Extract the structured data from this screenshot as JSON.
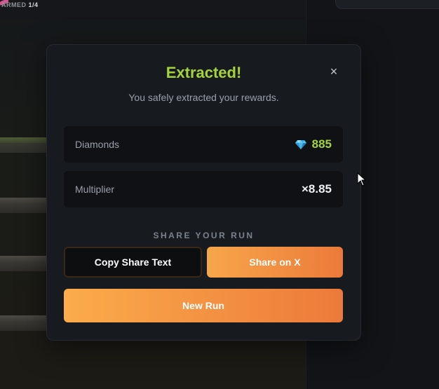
{
  "game": {
    "armed_label": "ARMED",
    "armed_count": "1/4"
  },
  "modal": {
    "title": "Extracted!",
    "subtitle": "You safely extracted your rewards.",
    "close_icon": "close-icon",
    "stats": {
      "diamonds_label": "Diamonds",
      "diamonds_value": "885",
      "diamonds_icon": "diamond-icon",
      "multiplier_label": "Multiplier",
      "multiplier_value": "×8.85"
    },
    "share_heading": "SHARE YOUR RUN",
    "copy_share_label": "Copy Share Text",
    "share_x_label": "Share on X",
    "new_run_label": "New Run"
  },
  "colors": {
    "accent_green": "#a6d33b",
    "accent_orange": "#f7a64a",
    "modal_bg": "#171b20",
    "row_bg": "#0f1114"
  }
}
